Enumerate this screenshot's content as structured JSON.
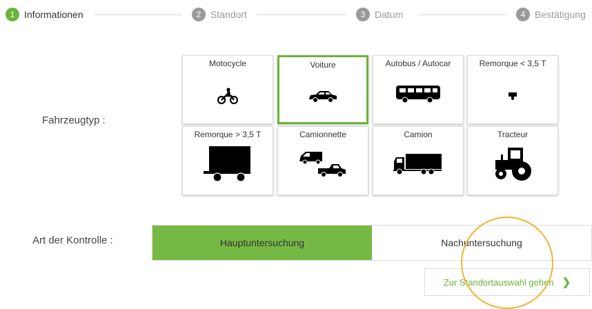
{
  "stepper": {
    "steps": [
      {
        "num": "1",
        "label": "Informationen"
      },
      {
        "num": "2",
        "label": "Standort"
      },
      {
        "num": "3",
        "label": "Datum"
      },
      {
        "num": "4",
        "label": "Bestätigung"
      }
    ],
    "active_step": 1
  },
  "vehicle": {
    "label": "Fahrzeugtyp :",
    "selected": "Voiture",
    "types": [
      {
        "label": "Motocycle",
        "icon": "motorcycle-icon"
      },
      {
        "label": "Voiture",
        "icon": "car-icon"
      },
      {
        "label": "Autobus / Autocar",
        "icon": "bus-icon"
      },
      {
        "label": "Remorque < 3,5 T",
        "icon": "small-trailer-icon"
      },
      {
        "label": "Remorque > 3,5 T",
        "icon": "large-trailer-icon"
      },
      {
        "label": "Camionnette",
        "icon": "van-icon"
      },
      {
        "label": "Camion",
        "icon": "truck-icon"
      },
      {
        "label": "Tracteur",
        "icon": "tractor-icon"
      }
    ]
  },
  "control": {
    "label": "Art der Kontrolle :",
    "options": [
      "Hauptuntersuchung",
      "Nachuntersuchung"
    ],
    "selected": "Hauptuntersuchung"
  },
  "next_button": {
    "label": "Zur Standortauswahl gehen",
    "icon": "chevron-right-icon"
  },
  "colors": {
    "accent": "#6ab43a",
    "inactive": "#9a9a9a",
    "highlight": "#f2b233"
  }
}
